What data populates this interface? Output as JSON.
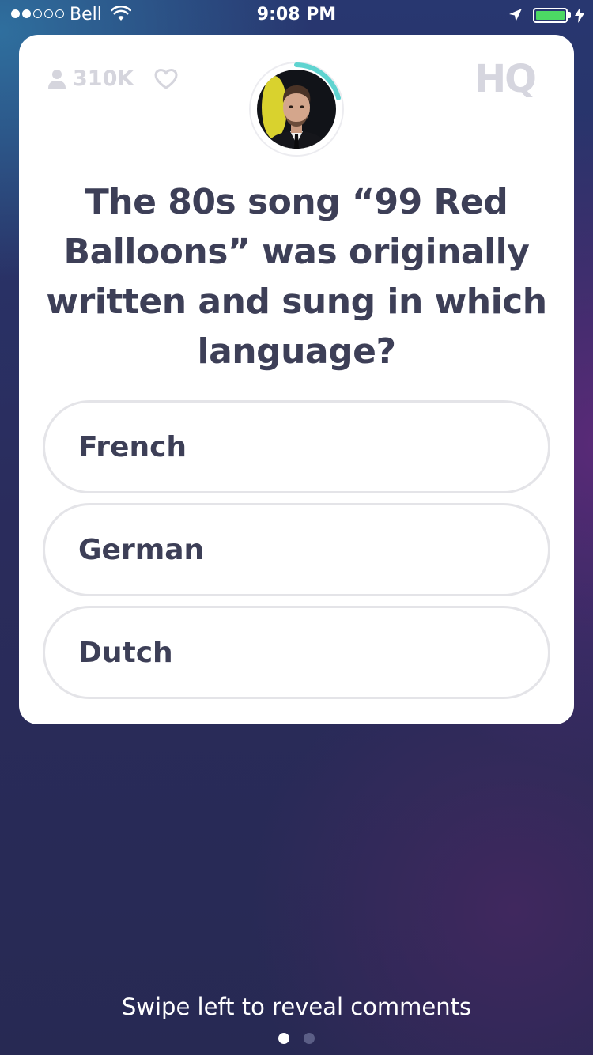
{
  "status_bar": {
    "carrier": "Bell",
    "time": "9:08 PM",
    "signal_filled": 2,
    "signal_total": 5,
    "battery_level": 1.0,
    "battery_color": "#4cd964",
    "icons": [
      "wifi-icon",
      "location-arrow-icon",
      "battery-icon",
      "charging-bolt-icon"
    ]
  },
  "card": {
    "viewer_count": "310K",
    "viewer_icon": "person-icon",
    "like_icon": "heart-outline-icon",
    "logo": "HQ",
    "host_avatar_icon": "host-avatar",
    "timer_ring_color": "#5fd4d0",
    "question": "The 80s song “99 Red Balloons” was originally written and sung in which language?",
    "answers": [
      {
        "label": "French"
      },
      {
        "label": "German"
      },
      {
        "label": "Dutch"
      }
    ]
  },
  "footer": {
    "swipe_hint": "Swipe left to reveal comments",
    "page_count": 2,
    "active_page": 1
  },
  "colors": {
    "background": "#2a2c5c",
    "card": "#ffffff",
    "text_dark": "#3d3f57",
    "muted": "#d5d5dd",
    "answer_border": "#e4e4e8"
  }
}
